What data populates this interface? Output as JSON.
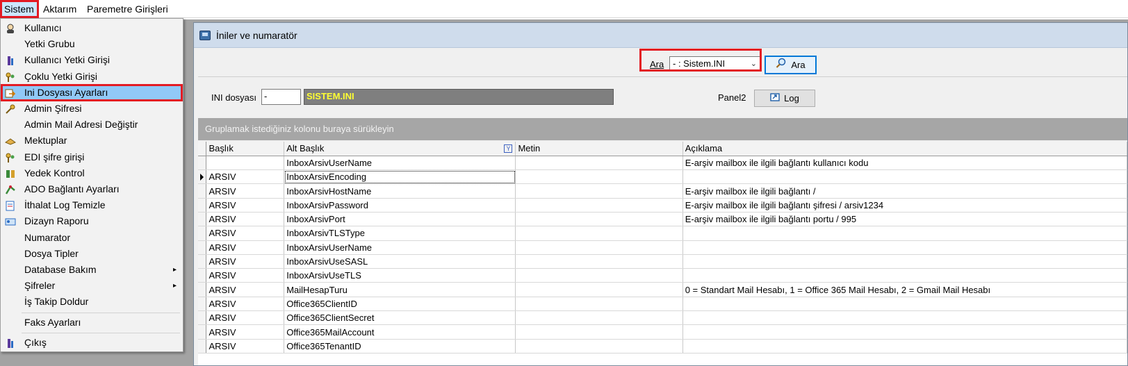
{
  "menubar": {
    "items": [
      "Sistem",
      "Aktarım",
      "Paremetre Girişleri"
    ]
  },
  "sistem_menu": {
    "items": [
      {
        "label": "Kullanıcı",
        "icon": "user-icon"
      },
      {
        "label": "Yetki Grubu",
        "icon": ""
      },
      {
        "label": "Kullanıcı Yetki Girişi",
        "icon": "user-permission-icon"
      },
      {
        "label": "Çoklu Yetki Girişi",
        "icon": "multi-key-icon"
      },
      {
        "label": "Ini Dosyası  Ayarları",
        "icon": "ini-settings-icon"
      },
      {
        "label": "Admin Şifresi",
        "icon": "key-icon"
      },
      {
        "label": "Admin Mail Adresi Değiştir",
        "icon": ""
      },
      {
        "label": "Mektuplar",
        "icon": "letter-icon"
      },
      {
        "label": "EDI şifre girişi",
        "icon": "multi-key-icon"
      },
      {
        "label": "Yedek Kontrol",
        "icon": "backup-icon"
      },
      {
        "label": "ADO Bağlantı Ayarları",
        "icon": "connection-icon"
      },
      {
        "label": "İthalat Log Temizle",
        "icon": "log-clean-icon"
      },
      {
        "label": "Dizayn Raporu",
        "icon": "report-icon"
      },
      {
        "label": "Numarator",
        "icon": ""
      },
      {
        "label": "Dosya Tipler",
        "icon": ""
      },
      {
        "label": "Database Bakım",
        "icon": "",
        "submenu": "▸"
      },
      {
        "label": "Şifreler",
        "icon": "",
        "submenu": "▸"
      },
      {
        "label": "İş Takip Doldur",
        "icon": ""
      },
      {
        "label": "Faks Ayarları",
        "icon": ""
      },
      {
        "label": "Çıkış",
        "icon": "exit-icon"
      }
    ]
  },
  "window": {
    "title": "İniler ve numaratör"
  },
  "search": {
    "label": "Ara",
    "value": "- : Sistem.INI",
    "button": "Ara"
  },
  "ini": {
    "label": "INI dosyası",
    "value": "-",
    "name": "SISTEM.INI",
    "panel_label": "Panel2",
    "log_button": "Log"
  },
  "grid": {
    "group_hint": "Gruplamak istediğiniz kolonu buraya sürükleyin",
    "columns": [
      "Başlık",
      "Alt Başlık",
      "Metin",
      "Açıklama"
    ],
    "rows": [
      [
        "",
        "InboxArsivUserName",
        "",
        "E-arşiv mailbox ile ilgili bağlantı kullanıcı kodu"
      ],
      [
        "ARSIV",
        "InboxArsivEncoding",
        "",
        ""
      ],
      [
        "ARSIV",
        "InboxArsivHostName",
        "",
        "E-arşiv mailbox ile ilgili bağlantı /"
      ],
      [
        "ARSIV",
        "InboxArsivPassword",
        "",
        "E-arşiv mailbox ile ilgili bağlantı şifresi / arsiv1234"
      ],
      [
        "ARSIV",
        "InboxArsivPort",
        "",
        "E-arşiv mailbox ile ilgili bağlantı portu / 995"
      ],
      [
        "ARSIV",
        "InboxArsivTLSType",
        "",
        ""
      ],
      [
        "ARSIV",
        "InboxArsivUserName",
        "",
        ""
      ],
      [
        "ARSIV",
        "InboxArsivUseSASL",
        "",
        ""
      ],
      [
        "ARSIV",
        "InboxArsivUseTLS",
        "",
        ""
      ],
      [
        "ARSIV",
        "MailHesapTuru",
        "",
        "0 = Standart Mail Hesabı, 1 = Office 365 Mail Hesabı, 2 = Gmail Mail Hesabı"
      ],
      [
        "ARSIV",
        "Office365ClientID",
        "",
        ""
      ],
      [
        "ARSIV",
        "Office365ClientSecret",
        "",
        ""
      ],
      [
        "ARSIV",
        "Office365MailAccount",
        "",
        ""
      ],
      [
        "ARSIV",
        "Office365TenantID",
        "",
        ""
      ]
    ],
    "current_row": 1
  },
  "colors": {
    "highlight_red": "#e31b23",
    "menu_highlight": "#91c9f7",
    "ini_name_text": "#ffff33"
  }
}
